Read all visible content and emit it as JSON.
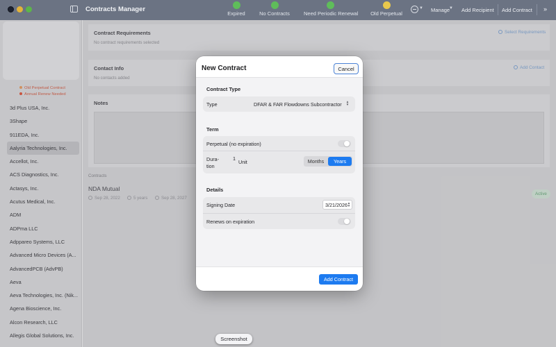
{
  "app": {
    "title": "Contracts Manager"
  },
  "status_filters": [
    {
      "label": "Expired",
      "color": "#5fbd5a"
    },
    {
      "label": "No Contracts",
      "color": "#5fbd5a"
    },
    {
      "label": "Need Periodic Renewal",
      "color": "#5fbd5a"
    },
    {
      "label": "Old Perpetual",
      "color": "#e9c84c"
    }
  ],
  "toolbar": {
    "manage": "Manage",
    "add_recipient": "Add Recipient",
    "add_contract": "Add Contract"
  },
  "sidebar": {
    "legend": [
      {
        "label": "Old Perpetual Contract",
        "color": "#e29a62"
      },
      {
        "label": "Annual Renew Needed",
        "color": "#d9563f"
      }
    ],
    "companies": [
      "3d Plus USA, Inc.",
      "3Shape",
      "911EDA, Inc.",
      "Aalyria Technologies, Inc.",
      "Accellot, Inc.",
      "ACS Diagnostics, Inc.",
      "Actasys, Inc.",
      "Acutus Medical, Inc.",
      "ADM",
      "ADPma LLC",
      "Adppareo Systems, LLC",
      "Advanced Micro Devices (A...",
      "AdvancedPCB (AdvPB)",
      "Aeva",
      "Aeva Technologies, Inc. (Nik...",
      "Agena Bioscience, Inc.",
      "Alcon Research, LLC",
      "Allegis Global Solutions, Inc."
    ],
    "selected_index": 3
  },
  "detail": {
    "requirements_title": "Contract Requirements",
    "requirements_empty": "No contract requirements selected",
    "select_requirements": "Select Requirements",
    "contact_title": "Contact Info",
    "contact_empty": "No contacts added",
    "add_contact": "Add Contact",
    "notes_title": "Notes",
    "contracts_label": "Contracts",
    "contract": {
      "name": "NDA Mutual",
      "signed": "Sep 28, 2022",
      "duration": "5 years",
      "expires": "Sep 28, 2027",
      "status": "Active"
    }
  },
  "sheet": {
    "title": "New Contract",
    "cancel": "Cancel",
    "type_section": "Contract Type",
    "type_label": "Type",
    "type_value": "DFAR & FAR Flowdowns Subcontractor",
    "term_section": "Term",
    "perpetual_label": "Perpetual (no expiration)",
    "perpetual_on": false,
    "duration_label_1": "Dura-",
    "duration_label_2": "tion",
    "duration_value": "1",
    "duration_unit": "Unit",
    "unit_options": [
      "Months",
      "Years"
    ],
    "unit_selected": "Years",
    "details_section": "Details",
    "signing_date_label": "Signing Date",
    "signing_date": "3/21/2026",
    "renews_label": "Renews on expiration",
    "renews_on": false,
    "add_button": "Add Contract"
  },
  "tooltip": "Screenshot"
}
